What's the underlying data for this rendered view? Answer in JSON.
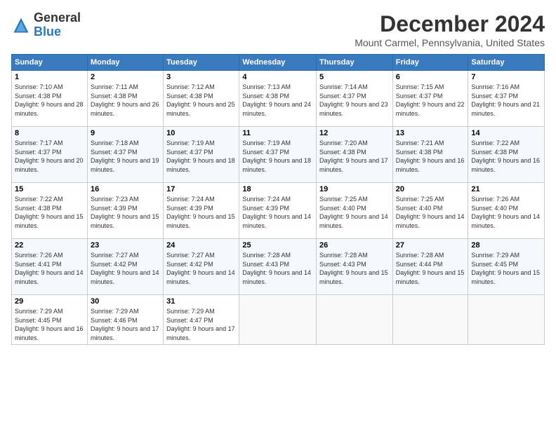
{
  "logo": {
    "general": "General",
    "blue": "Blue"
  },
  "header": {
    "month_title": "December 2024",
    "location": "Mount Carmel, Pennsylvania, United States"
  },
  "days_of_week": [
    "Sunday",
    "Monday",
    "Tuesday",
    "Wednesday",
    "Thursday",
    "Friday",
    "Saturday"
  ],
  "weeks": [
    [
      {
        "day": "1",
        "sunrise": "Sunrise: 7:10 AM",
        "sunset": "Sunset: 4:38 PM",
        "daylight": "Daylight: 9 hours and 28 minutes."
      },
      {
        "day": "2",
        "sunrise": "Sunrise: 7:11 AM",
        "sunset": "Sunset: 4:38 PM",
        "daylight": "Daylight: 9 hours and 26 minutes."
      },
      {
        "day": "3",
        "sunrise": "Sunrise: 7:12 AM",
        "sunset": "Sunset: 4:38 PM",
        "daylight": "Daylight: 9 hours and 25 minutes."
      },
      {
        "day": "4",
        "sunrise": "Sunrise: 7:13 AM",
        "sunset": "Sunset: 4:38 PM",
        "daylight": "Daylight: 9 hours and 24 minutes."
      },
      {
        "day": "5",
        "sunrise": "Sunrise: 7:14 AM",
        "sunset": "Sunset: 4:37 PM",
        "daylight": "Daylight: 9 hours and 23 minutes."
      },
      {
        "day": "6",
        "sunrise": "Sunrise: 7:15 AM",
        "sunset": "Sunset: 4:37 PM",
        "daylight": "Daylight: 9 hours and 22 minutes."
      },
      {
        "day": "7",
        "sunrise": "Sunrise: 7:16 AM",
        "sunset": "Sunset: 4:37 PM",
        "daylight": "Daylight: 9 hours and 21 minutes."
      }
    ],
    [
      {
        "day": "8",
        "sunrise": "Sunrise: 7:17 AM",
        "sunset": "Sunset: 4:37 PM",
        "daylight": "Daylight: 9 hours and 20 minutes."
      },
      {
        "day": "9",
        "sunrise": "Sunrise: 7:18 AM",
        "sunset": "Sunset: 4:37 PM",
        "daylight": "Daylight: 9 hours and 19 minutes."
      },
      {
        "day": "10",
        "sunrise": "Sunrise: 7:19 AM",
        "sunset": "Sunset: 4:37 PM",
        "daylight": "Daylight: 9 hours and 18 minutes."
      },
      {
        "day": "11",
        "sunrise": "Sunrise: 7:19 AM",
        "sunset": "Sunset: 4:37 PM",
        "daylight": "Daylight: 9 hours and 18 minutes."
      },
      {
        "day": "12",
        "sunrise": "Sunrise: 7:20 AM",
        "sunset": "Sunset: 4:38 PM",
        "daylight": "Daylight: 9 hours and 17 minutes."
      },
      {
        "day": "13",
        "sunrise": "Sunrise: 7:21 AM",
        "sunset": "Sunset: 4:38 PM",
        "daylight": "Daylight: 9 hours and 16 minutes."
      },
      {
        "day": "14",
        "sunrise": "Sunrise: 7:22 AM",
        "sunset": "Sunset: 4:38 PM",
        "daylight": "Daylight: 9 hours and 16 minutes."
      }
    ],
    [
      {
        "day": "15",
        "sunrise": "Sunrise: 7:22 AM",
        "sunset": "Sunset: 4:38 PM",
        "daylight": "Daylight: 9 hours and 15 minutes."
      },
      {
        "day": "16",
        "sunrise": "Sunrise: 7:23 AM",
        "sunset": "Sunset: 4:39 PM",
        "daylight": "Daylight: 9 hours and 15 minutes."
      },
      {
        "day": "17",
        "sunrise": "Sunrise: 7:24 AM",
        "sunset": "Sunset: 4:39 PM",
        "daylight": "Daylight: 9 hours and 15 minutes."
      },
      {
        "day": "18",
        "sunrise": "Sunrise: 7:24 AM",
        "sunset": "Sunset: 4:39 PM",
        "daylight": "Daylight: 9 hours and 14 minutes."
      },
      {
        "day": "19",
        "sunrise": "Sunrise: 7:25 AM",
        "sunset": "Sunset: 4:40 PM",
        "daylight": "Daylight: 9 hours and 14 minutes."
      },
      {
        "day": "20",
        "sunrise": "Sunrise: 7:25 AM",
        "sunset": "Sunset: 4:40 PM",
        "daylight": "Daylight: 9 hours and 14 minutes."
      },
      {
        "day": "21",
        "sunrise": "Sunrise: 7:26 AM",
        "sunset": "Sunset: 4:40 PM",
        "daylight": "Daylight: 9 hours and 14 minutes."
      }
    ],
    [
      {
        "day": "22",
        "sunrise": "Sunrise: 7:26 AM",
        "sunset": "Sunset: 4:41 PM",
        "daylight": "Daylight: 9 hours and 14 minutes."
      },
      {
        "day": "23",
        "sunrise": "Sunrise: 7:27 AM",
        "sunset": "Sunset: 4:42 PM",
        "daylight": "Daylight: 9 hours and 14 minutes."
      },
      {
        "day": "24",
        "sunrise": "Sunrise: 7:27 AM",
        "sunset": "Sunset: 4:42 PM",
        "daylight": "Daylight: 9 hours and 14 minutes."
      },
      {
        "day": "25",
        "sunrise": "Sunrise: 7:28 AM",
        "sunset": "Sunset: 4:43 PM",
        "daylight": "Daylight: 9 hours and 14 minutes."
      },
      {
        "day": "26",
        "sunrise": "Sunrise: 7:28 AM",
        "sunset": "Sunset: 4:43 PM",
        "daylight": "Daylight: 9 hours and 15 minutes."
      },
      {
        "day": "27",
        "sunrise": "Sunrise: 7:28 AM",
        "sunset": "Sunset: 4:44 PM",
        "daylight": "Daylight: 9 hours and 15 minutes."
      },
      {
        "day": "28",
        "sunrise": "Sunrise: 7:29 AM",
        "sunset": "Sunset: 4:45 PM",
        "daylight": "Daylight: 9 hours and 15 minutes."
      }
    ],
    [
      {
        "day": "29",
        "sunrise": "Sunrise: 7:29 AM",
        "sunset": "Sunset: 4:45 PM",
        "daylight": "Daylight: 9 hours and 16 minutes."
      },
      {
        "day": "30",
        "sunrise": "Sunrise: 7:29 AM",
        "sunset": "Sunset: 4:46 PM",
        "daylight": "Daylight: 9 hours and 17 minutes."
      },
      {
        "day": "31",
        "sunrise": "Sunrise: 7:29 AM",
        "sunset": "Sunset: 4:47 PM",
        "daylight": "Daylight: 9 hours and 17 minutes."
      },
      null,
      null,
      null,
      null
    ]
  ]
}
